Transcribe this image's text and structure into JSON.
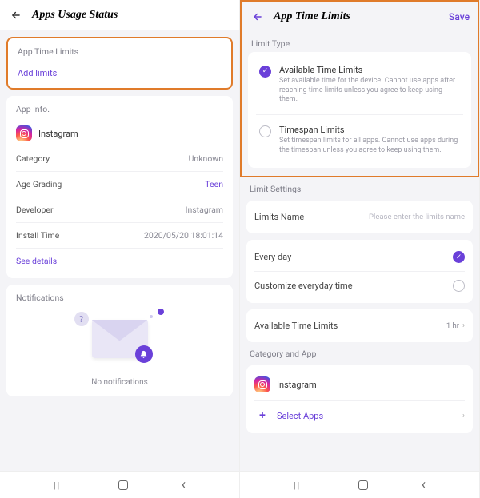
{
  "left": {
    "header_title": "Apps Usage Status",
    "time_limits_heading": "App Time Limits",
    "add_limits": "Add limits",
    "app_info_heading": "App info.",
    "app_name": "Instagram",
    "rows": {
      "category_label": "Category",
      "category_value": "Unknown",
      "age_label": "Age Grading",
      "age_value": "Teen",
      "developer_label": "Developer",
      "developer_value": "Instagram",
      "install_label": "Install Time",
      "install_value": "2020/05/20 18:01:14"
    },
    "see_details": "See details",
    "notifications_heading": "Notifications",
    "no_notifications": "No notifications"
  },
  "right": {
    "header_title": "App Time Limits",
    "save": "Save",
    "limit_type_heading": "Limit Type",
    "available": {
      "title": "Available Time Limits",
      "desc": "Set available time for the device. Cannot use apps after reaching time limits unless you agree to keep using them."
    },
    "timespan": {
      "title": "Timespan Limits",
      "desc": "Set timespan limits for all apps. Cannot use apps during the timespan unless you agree to keep using them."
    },
    "limit_settings_heading": "Limit Settings",
    "limits_name_label": "Limits Name",
    "limits_name_placeholder": "Please enter the limits name",
    "every_day": "Every day",
    "customize": "Customize everyday time",
    "available_row_label": "Available Time Limits",
    "available_row_value": "1 hr",
    "category_app_heading": "Category and App",
    "app_name": "Instagram",
    "select_apps": "Select Apps"
  }
}
